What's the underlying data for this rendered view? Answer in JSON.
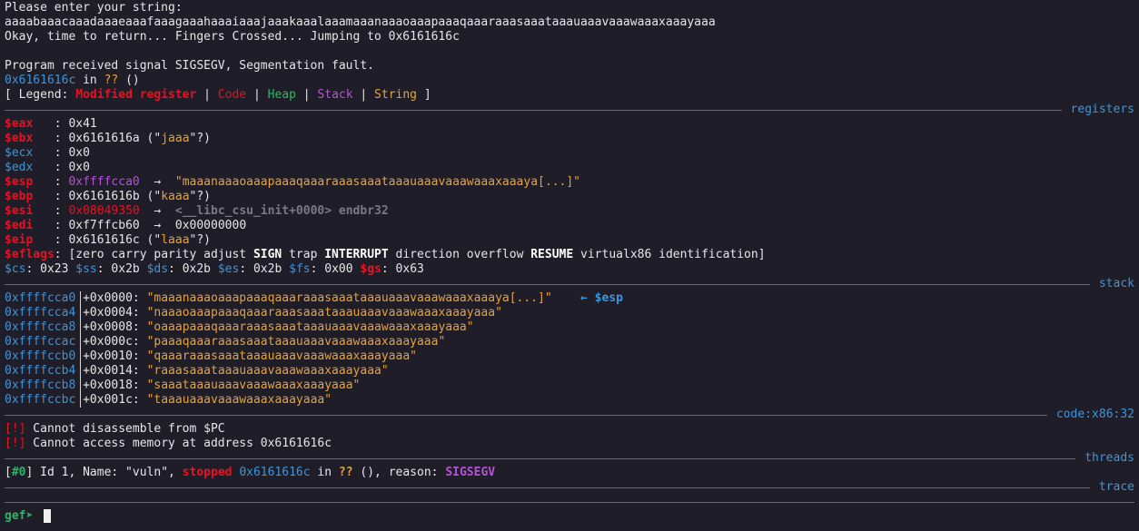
{
  "intro": {
    "l1": "Please enter your string:",
    "l2": "aaaabaaacaaadaaaeaaafaaagaaahaaaiaaajaaakaaalaaamaaanaaaoaaapaaaqaaaraaasaaataaauaaavaaawaaaxaaayaaa",
    "l3": "Okay, time to return... Fingers Crossed... Jumping to 0x6161616c",
    "l4": "Program received signal SIGSEGV, Segmentation fault.",
    "l5_addr": "0x6161616c",
    "l5_in": " in ",
    "l5_q": "??",
    "l5_end": " ()"
  },
  "legend": {
    "open": "[ Legend: ",
    "modified": "Modified register",
    "code": "Code",
    "heap": "Heap",
    "stack": "Stack",
    "string": "String",
    "sep": " | ",
    "close": " ]"
  },
  "sections": {
    "registers": "registers",
    "stack": "stack",
    "code": "code:x86:32",
    "threads": "threads",
    "trace": "trace"
  },
  "registers": {
    "eax": {
      "name": "$eax",
      "pad": "   : ",
      "value": "0x41"
    },
    "ebx": {
      "name": "$ebx",
      "pad": "   : ",
      "value": "0x6161616a",
      "open": " (\"",
      "str": "jaaa",
      "close": "\"?)"
    },
    "ecx": {
      "name": "$ecx",
      "pad": "   : ",
      "value": "0x0"
    },
    "edx": {
      "name": "$edx",
      "pad": "   : ",
      "value": "0x0"
    },
    "esp": {
      "name": "$esp",
      "pad": "   : ",
      "value": "0xffffcca0",
      "arrow": "  →  ",
      "str": "\"maaanaaaoaaapaaaqaaaraaasaaataaauaaavaaawaaaxaaaya[...]\""
    },
    "ebp": {
      "name": "$ebp",
      "pad": "   : ",
      "value": "0x6161616b",
      "open": " (\"",
      "str": "kaaa",
      "close": "\"?)"
    },
    "esi": {
      "name": "$esi",
      "pad": "   : ",
      "value": "0x08049350",
      "arrow": "  →  ",
      "str": "<__libc_csu_init+0000> endbr32"
    },
    "edi": {
      "name": "$edi",
      "pad": "   : ",
      "value": "0xf7ffcb60",
      "arrow": "  →  ",
      "str": "0x00000000"
    },
    "eip": {
      "name": "$eip",
      "pad": "   : ",
      "value": "0x6161616c",
      "open": " (\"",
      "str": "laaa",
      "close": "\"?)"
    },
    "eflags": {
      "name": "$eflags",
      "pad": ": ",
      "p1": "[zero carry parity adjust ",
      "sign": "SIGN",
      "p2": " trap ",
      "interrupt": "INTERRUPT",
      "p3": " direction overflow ",
      "resume": "RESUME",
      "p4": " virtualx86 identification]"
    },
    "segs": {
      "cs_n": "$cs",
      "cs_v": ": 0x23 ",
      "ss_n": "$ss",
      "ss_v": ": 0x2b ",
      "ds_n": "$ds",
      "ds_v": ": 0x2b ",
      "es_n": "$es",
      "es_v": ": 0x2b ",
      "fs_n": "$fs",
      "fs_v": ": 0x00 ",
      "gs_n": "$gs",
      "gs_v": ": 0x63"
    }
  },
  "stack": [
    {
      "addr": "0xffffcca0",
      "off": "+0x0000: ",
      "str": "\"maaanaaaoaaapaaaqaaaraaasaaataaauaaavaaawaaaxaaaya[...]\"",
      "tag": "    ← $esp"
    },
    {
      "addr": "0xffffcca4",
      "off": "+0x0004: ",
      "str": "\"naaaoaaapaaaqaaaraaasaaataaauaaavaaawaaaxaaayaaa\"",
      "tag": ""
    },
    {
      "addr": "0xffffcca8",
      "off": "+0x0008: ",
      "str": "\"oaaapaaaqaaaraaasaaataaauaaavaaawaaaxaaayaaa\"",
      "tag": ""
    },
    {
      "addr": "0xffffccac",
      "off": "+0x000c: ",
      "str": "\"paaaqaaaraaasaaataaauaaavaaawaaaxaaayaaa\"",
      "tag": ""
    },
    {
      "addr": "0xffffccb0",
      "off": "+0x0010: ",
      "str": "\"qaaaraaasaaataaauaaavaaawaaaxaaayaaa\"",
      "tag": ""
    },
    {
      "addr": "0xffffccb4",
      "off": "+0x0014: ",
      "str": "\"raaasaaataaauaaavaaawaaaxaaayaaa\"",
      "tag": ""
    },
    {
      "addr": "0xffffccb8",
      "off": "+0x0018: ",
      "str": "\"saaataaauaaavaaawaaaxaaayaaa\"",
      "tag": ""
    },
    {
      "addr": "0xffffccbc",
      "off": "+0x001c: ",
      "str": "\"taaauaaavaaawaaaxaaayaaa\"",
      "tag": ""
    }
  ],
  "code": {
    "mark": "[!]",
    "msg1": " Cannot disassemble from $PC",
    "msg2": " Cannot access memory at address 0x6161616c"
  },
  "threads": {
    "open": "[",
    "num": "#0",
    "close": "]",
    "p1": " Id 1, Name: \"vuln\", ",
    "stopped": "stopped",
    "sp": " ",
    "addr": "0x6161616c",
    "in": " in ",
    "q": "??",
    "reason": " (), reason: ",
    "signal": "SIGSEGV"
  },
  "prompt": "gef➤ "
}
